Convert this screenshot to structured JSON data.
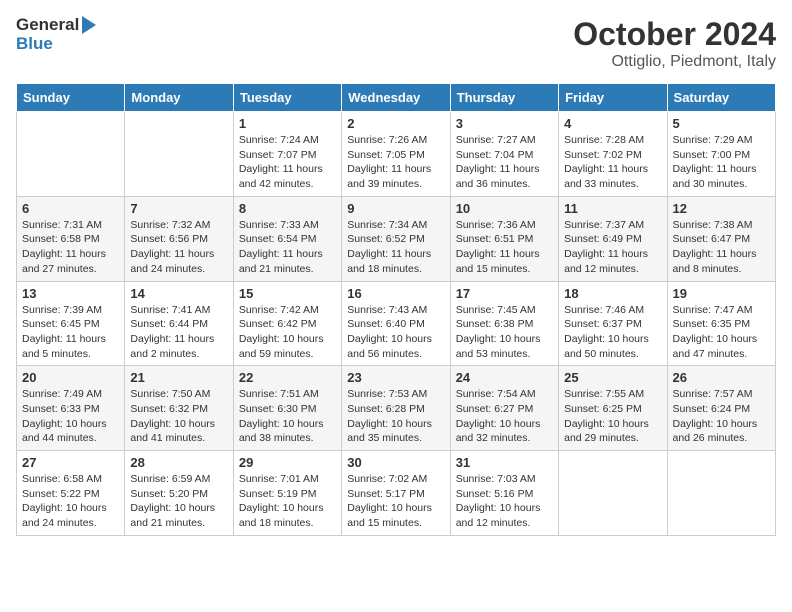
{
  "header": {
    "logo_general": "General",
    "logo_blue": "Blue",
    "title": "October 2024",
    "subtitle": "Ottiglio, Piedmont, Italy"
  },
  "calendar": {
    "days_of_week": [
      "Sunday",
      "Monday",
      "Tuesday",
      "Wednesday",
      "Thursday",
      "Friday",
      "Saturday"
    ],
    "weeks": [
      [
        {
          "day": "",
          "info": ""
        },
        {
          "day": "",
          "info": ""
        },
        {
          "day": "1",
          "info": "Sunrise: 7:24 AM\nSunset: 7:07 PM\nDaylight: 11 hours and 42 minutes."
        },
        {
          "day": "2",
          "info": "Sunrise: 7:26 AM\nSunset: 7:05 PM\nDaylight: 11 hours and 39 minutes."
        },
        {
          "day": "3",
          "info": "Sunrise: 7:27 AM\nSunset: 7:04 PM\nDaylight: 11 hours and 36 minutes."
        },
        {
          "day": "4",
          "info": "Sunrise: 7:28 AM\nSunset: 7:02 PM\nDaylight: 11 hours and 33 minutes."
        },
        {
          "day": "5",
          "info": "Sunrise: 7:29 AM\nSunset: 7:00 PM\nDaylight: 11 hours and 30 minutes."
        }
      ],
      [
        {
          "day": "6",
          "info": "Sunrise: 7:31 AM\nSunset: 6:58 PM\nDaylight: 11 hours and 27 minutes."
        },
        {
          "day": "7",
          "info": "Sunrise: 7:32 AM\nSunset: 6:56 PM\nDaylight: 11 hours and 24 minutes."
        },
        {
          "day": "8",
          "info": "Sunrise: 7:33 AM\nSunset: 6:54 PM\nDaylight: 11 hours and 21 minutes."
        },
        {
          "day": "9",
          "info": "Sunrise: 7:34 AM\nSunset: 6:52 PM\nDaylight: 11 hours and 18 minutes."
        },
        {
          "day": "10",
          "info": "Sunrise: 7:36 AM\nSunset: 6:51 PM\nDaylight: 11 hours and 15 minutes."
        },
        {
          "day": "11",
          "info": "Sunrise: 7:37 AM\nSunset: 6:49 PM\nDaylight: 11 hours and 12 minutes."
        },
        {
          "day": "12",
          "info": "Sunrise: 7:38 AM\nSunset: 6:47 PM\nDaylight: 11 hours and 8 minutes."
        }
      ],
      [
        {
          "day": "13",
          "info": "Sunrise: 7:39 AM\nSunset: 6:45 PM\nDaylight: 11 hours and 5 minutes."
        },
        {
          "day": "14",
          "info": "Sunrise: 7:41 AM\nSunset: 6:44 PM\nDaylight: 11 hours and 2 minutes."
        },
        {
          "day": "15",
          "info": "Sunrise: 7:42 AM\nSunset: 6:42 PM\nDaylight: 10 hours and 59 minutes."
        },
        {
          "day": "16",
          "info": "Sunrise: 7:43 AM\nSunset: 6:40 PM\nDaylight: 10 hours and 56 minutes."
        },
        {
          "day": "17",
          "info": "Sunrise: 7:45 AM\nSunset: 6:38 PM\nDaylight: 10 hours and 53 minutes."
        },
        {
          "day": "18",
          "info": "Sunrise: 7:46 AM\nSunset: 6:37 PM\nDaylight: 10 hours and 50 minutes."
        },
        {
          "day": "19",
          "info": "Sunrise: 7:47 AM\nSunset: 6:35 PM\nDaylight: 10 hours and 47 minutes."
        }
      ],
      [
        {
          "day": "20",
          "info": "Sunrise: 7:49 AM\nSunset: 6:33 PM\nDaylight: 10 hours and 44 minutes."
        },
        {
          "day": "21",
          "info": "Sunrise: 7:50 AM\nSunset: 6:32 PM\nDaylight: 10 hours and 41 minutes."
        },
        {
          "day": "22",
          "info": "Sunrise: 7:51 AM\nSunset: 6:30 PM\nDaylight: 10 hours and 38 minutes."
        },
        {
          "day": "23",
          "info": "Sunrise: 7:53 AM\nSunset: 6:28 PM\nDaylight: 10 hours and 35 minutes."
        },
        {
          "day": "24",
          "info": "Sunrise: 7:54 AM\nSunset: 6:27 PM\nDaylight: 10 hours and 32 minutes."
        },
        {
          "day": "25",
          "info": "Sunrise: 7:55 AM\nSunset: 6:25 PM\nDaylight: 10 hours and 29 minutes."
        },
        {
          "day": "26",
          "info": "Sunrise: 7:57 AM\nSunset: 6:24 PM\nDaylight: 10 hours and 26 minutes."
        }
      ],
      [
        {
          "day": "27",
          "info": "Sunrise: 6:58 AM\nSunset: 5:22 PM\nDaylight: 10 hours and 24 minutes."
        },
        {
          "day": "28",
          "info": "Sunrise: 6:59 AM\nSunset: 5:20 PM\nDaylight: 10 hours and 21 minutes."
        },
        {
          "day": "29",
          "info": "Sunrise: 7:01 AM\nSunset: 5:19 PM\nDaylight: 10 hours and 18 minutes."
        },
        {
          "day": "30",
          "info": "Sunrise: 7:02 AM\nSunset: 5:17 PM\nDaylight: 10 hours and 15 minutes."
        },
        {
          "day": "31",
          "info": "Sunrise: 7:03 AM\nSunset: 5:16 PM\nDaylight: 10 hours and 12 minutes."
        },
        {
          "day": "",
          "info": ""
        },
        {
          "day": "",
          "info": ""
        }
      ]
    ]
  }
}
